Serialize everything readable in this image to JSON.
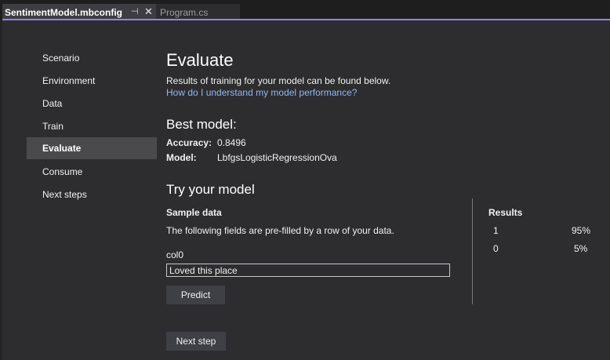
{
  "tabs": {
    "active": "SentimentModel.mbconfig",
    "inactive": "Program.cs",
    "pin_glyph": "⊣",
    "close_glyph": "✕"
  },
  "sidebar": {
    "items": [
      {
        "label": "Scenario"
      },
      {
        "label": "Environment"
      },
      {
        "label": "Data"
      },
      {
        "label": "Train"
      },
      {
        "label": "Evaluate"
      },
      {
        "label": "Consume"
      },
      {
        "label": "Next steps"
      }
    ],
    "active_index": 4
  },
  "evaluate": {
    "title": "Evaluate",
    "description": "Results of training for your model can be found below.",
    "help_link": "How do I understand my model performance?"
  },
  "best_model": {
    "heading": "Best model:",
    "accuracy_label": "Accuracy:",
    "accuracy_value": "0.8496",
    "model_label": "Model:",
    "model_value": "LbfgsLogisticRegressionOva"
  },
  "try_model": {
    "heading": "Try your model",
    "sample_heading": "Sample data",
    "sample_description": "The following fields are pre-filled by a row of your data.",
    "field_label": "col0",
    "field_value": "Loved this place",
    "predict_label": "Predict"
  },
  "results": {
    "heading": "Results",
    "rows": [
      {
        "label": "1",
        "value": "95%"
      },
      {
        "label": "0",
        "value": "5%"
      }
    ]
  },
  "next_step_label": "Next step",
  "colors": {
    "accent": "#9184ee",
    "link": "#8fb8f0",
    "background": "#2d2d30"
  }
}
